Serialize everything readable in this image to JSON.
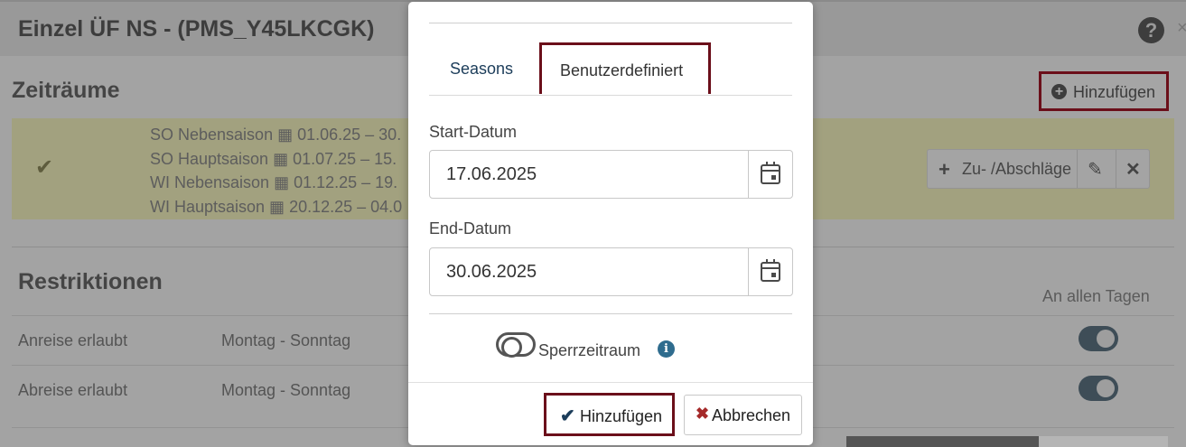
{
  "background": {
    "title": "Einzel ÜF NS - (PMS_Y45LKCGK)",
    "help_icon": "?",
    "close_icon": "×",
    "zeitraeume_title": "Zeiträume",
    "add_button_label": "Hinzufügen",
    "periods": [
      "SO Nebensaison ▦ 01.06.25 – 30.",
      "SO Hauptsaison ▦ 01.07.25 – 15.",
      "WI Nebensaison ▦ 01.12.25 – 19.",
      "WI Hauptsaison ▦ 20.12.25 – 04.0"
    ],
    "zu_abschlaege_label": "Zu- /Abschläge",
    "restriktionen_title": "Restriktionen",
    "an_allen_tagen": "An allen Tagen",
    "restrictions": [
      {
        "label": "Anreise erlaubt",
        "days": "Montag - Sonntag"
      },
      {
        "label": "Abreise erlaubt",
        "days": "Montag - Sonntag"
      }
    ]
  },
  "modal": {
    "tabs": [
      {
        "label": "Seasons",
        "active": false
      },
      {
        "label": "Benutzerdefiniert",
        "active": true
      }
    ],
    "start_label": "Start-Datum",
    "start_value": "17.06.2025",
    "end_label": "End-Datum",
    "end_value": "30.06.2025",
    "sperrzeitraum_label": "Sperrzeitraum",
    "sperrzeitraum_on": false,
    "info_icon": "i",
    "add_label": "Hinzufügen",
    "cancel_label": "Abbrechen"
  },
  "colors": {
    "highlight_border": "#6b0f1a",
    "link_blue": "#1c3d5a",
    "info_blue": "#2f6c8e",
    "cancel_red": "#a52a2a"
  }
}
